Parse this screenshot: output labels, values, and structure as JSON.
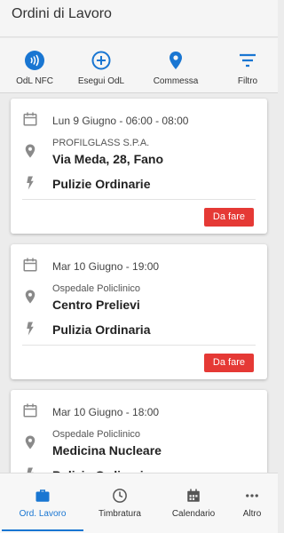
{
  "header": {
    "title": "Ordini di Lavoro"
  },
  "toolbar": {
    "nfc_label": "OdL NFC",
    "execute_label": "Esegui OdL",
    "commessa_label": "Commessa",
    "filter_label": "Filtro"
  },
  "orders": [
    {
      "datetime": "Lun 9 Giugno - 06:00 - 08:00",
      "client": "PROFILGLASS S.P.A.",
      "address": "Via Meda, 28, Fano",
      "work_type": "Pulizie Ordinarie",
      "status": "Da fare"
    },
    {
      "datetime": "Mar 10 Giugno - 19:00",
      "client": "Ospedale Policlinico",
      "address": "Centro Prelievi",
      "work_type": "Pulizia Ordinaria",
      "status": "Da fare"
    },
    {
      "datetime": "Mar 10 Giugno - 18:00",
      "client": "Ospedale Policlinico",
      "address": "Medicina Nucleare",
      "work_type": "Pulizia Ordinaria",
      "status": ""
    }
  ],
  "bottom_nav": {
    "orders_label": "Ord. Lavoro",
    "timbratura_label": "Timbratura",
    "calendar_label": "Calendario",
    "more_label": "Altro"
  },
  "icons": {
    "nfc": "nfc-icon",
    "add": "add-circle-icon",
    "location": "location-pin-icon",
    "filter": "filter-icon",
    "calendar": "calendar-icon",
    "bolt": "bolt-icon",
    "briefcase": "briefcase-icon",
    "clock": "clock-icon",
    "more": "more-dots-icon"
  },
  "colors": {
    "primary": "#1976d2",
    "status_todo": "#e53935",
    "icon_grey": "#8a8a8a"
  }
}
